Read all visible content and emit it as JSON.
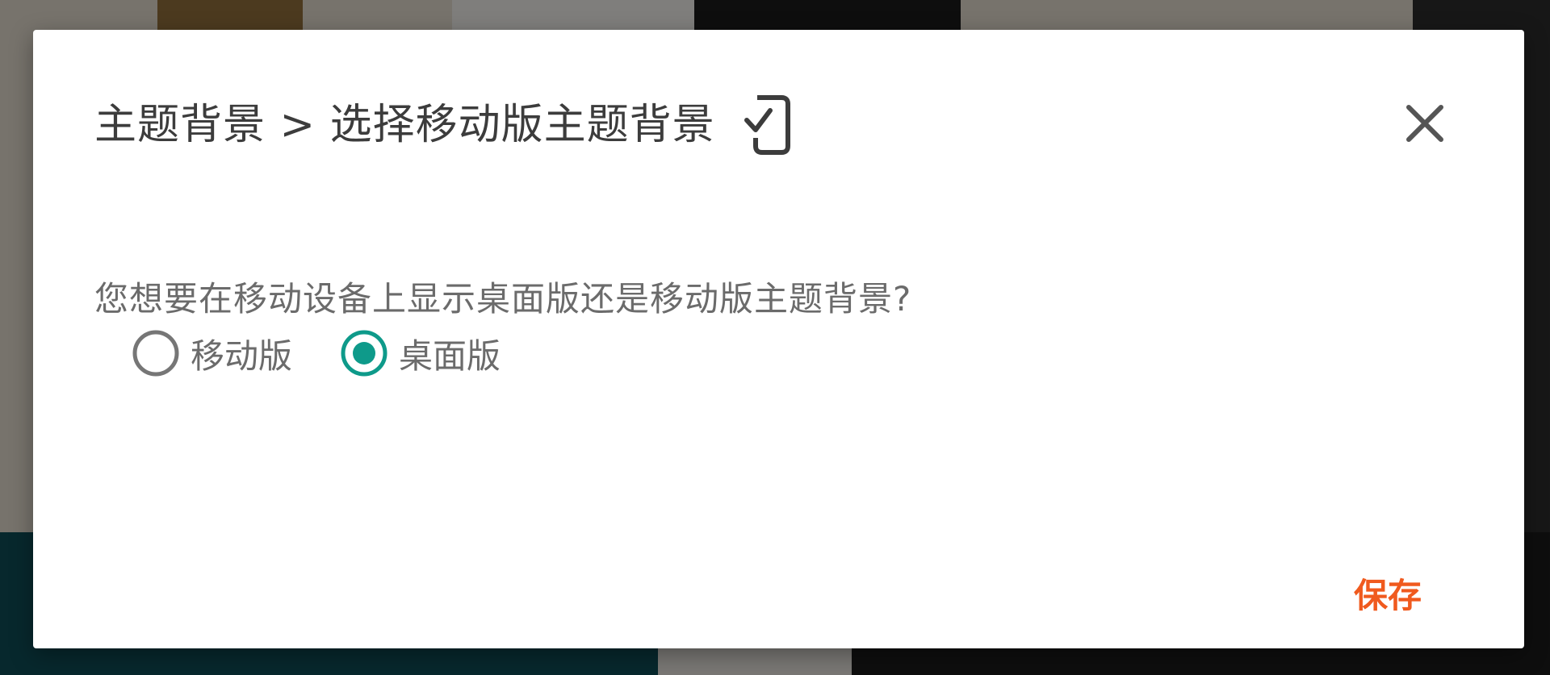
{
  "dialog": {
    "title": "主题背景 > 选择移动版主题背景",
    "icon": "mobile-check-icon",
    "close_icon": "close-icon",
    "question": "您想要在移动设备上显示桌面版还是移动版主题背景?",
    "options": [
      {
        "label": "移动版",
        "selected": false
      },
      {
        "label": "桌面版",
        "selected": true
      }
    ],
    "save_label": "保存"
  },
  "colors": {
    "accent": "#0e9a8a",
    "save": "#f05a1e",
    "title": "#3c3c3c",
    "text": "#6b6b6b"
  }
}
